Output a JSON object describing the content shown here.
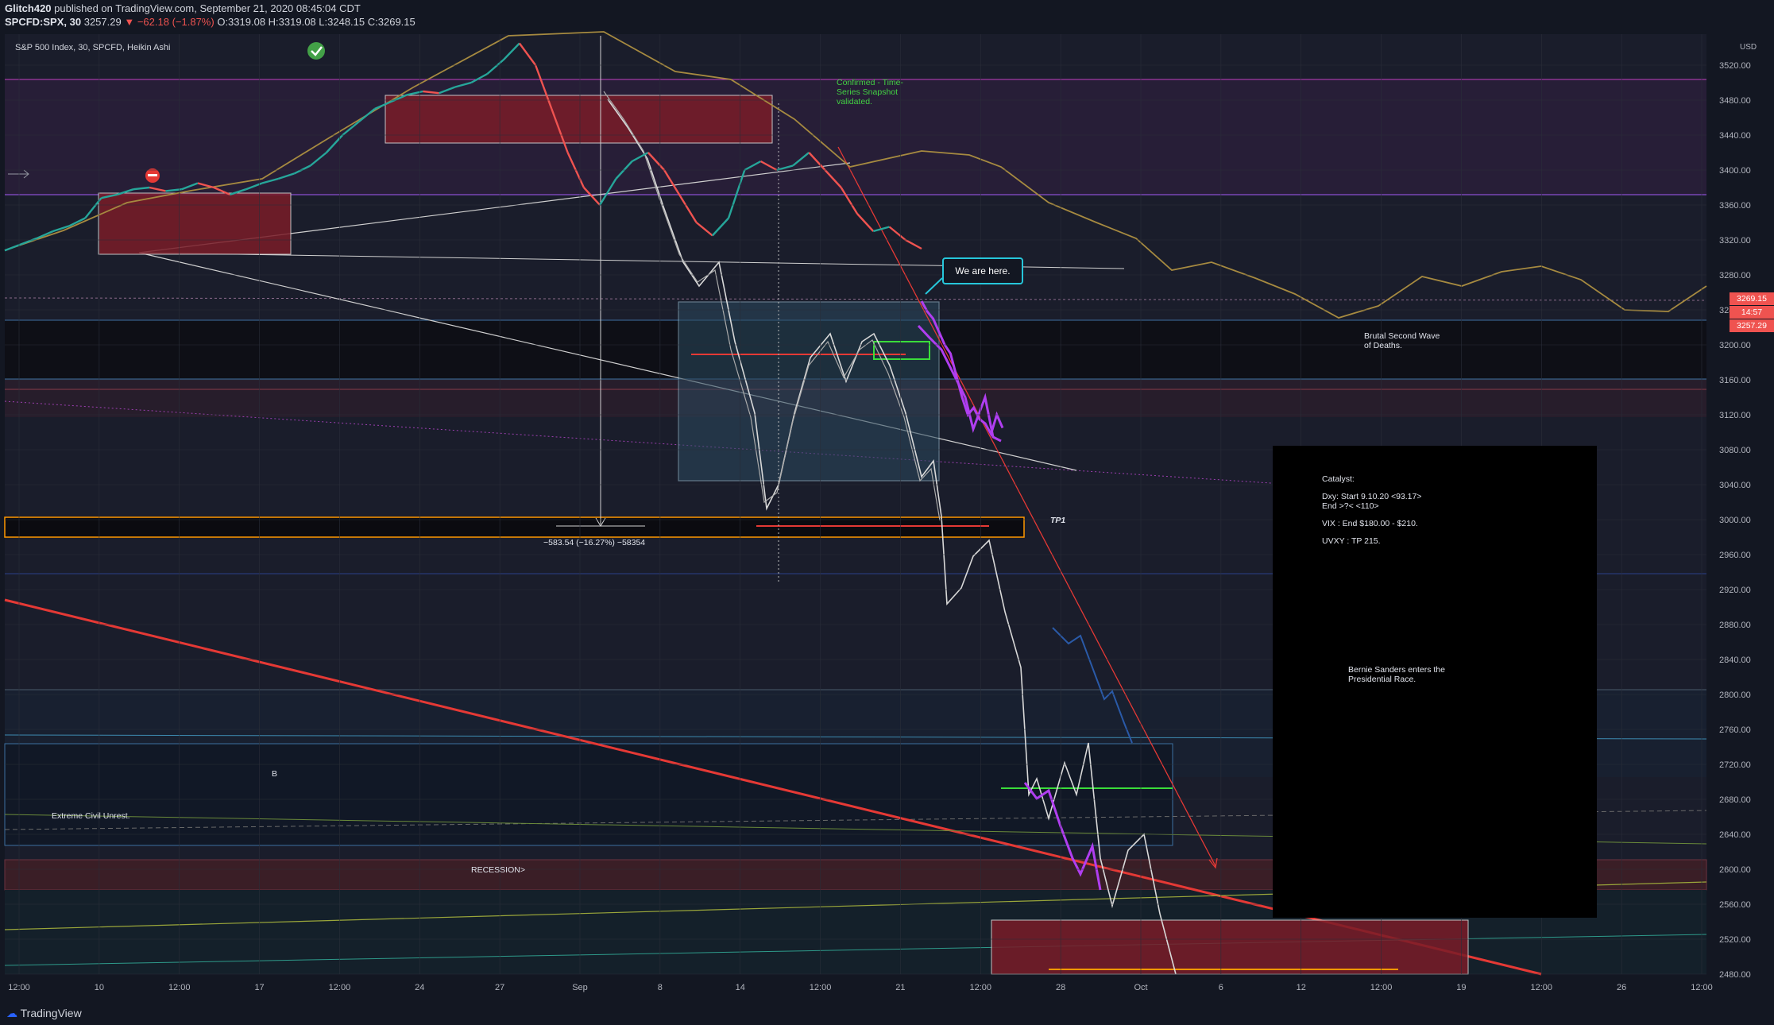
{
  "header": {
    "author": "Glitch420",
    "published": "published on TradingView.com, September 21, 2020 08:45:04 CDT",
    "symbol": "SPCFD:SPX, 30",
    "last": "3257.29",
    "change": "−62.18 (−1.87%)",
    "ohlc_o": "O:3319.08",
    "ohlc_h": "H:3319.08",
    "ohlc_l": "L:3248.15",
    "ohlc_c": "C:3269.15",
    "chart_title": "S&P 500 Index, 30, SPCFD, Heikin Ashi",
    "currency": "USD",
    "change_color": "#ef5350"
  },
  "footer": {
    "brand": "TradingView"
  },
  "annotations": {
    "confirmed": "Confirmed - Time-\nSeries Snapshot\nvalidated.",
    "we_are_here": "We are here.",
    "second_wave": "Brutal Second Wave\nof Deaths.",
    "tp1": "TP1",
    "measure": "−583.54 (−16.27%) −58354",
    "b_label": "B",
    "civil_unrest": "Extreme Civil Unrest.",
    "recession": "RECESSION>"
  },
  "catalyst": {
    "title": "Catalyst:",
    "dxy": "Dxy: Start 9.10.20 <93.17>\nEnd >?< <110>",
    "vix": "VIX : End $180.00 - $210.",
    "uvxy": "UVXY : TP 215.",
    "bernie": "Bernie Sanders enters the\nPresidential Race."
  },
  "price_tags": {
    "current": "3269.15",
    "countdown": "14:57",
    "last": "3257.29",
    "tag_color": "#ef5350"
  },
  "chart_data": {
    "type": "line",
    "title": "S&P 500 Index, 30, SPCFD, Heikin Ashi",
    "ylim": [
      2480,
      3540
    ],
    "y_ticks": [
      3520,
      3480,
      3440,
      3400,
      3360,
      3320,
      3280,
      3240,
      3200,
      3160,
      3120,
      3080,
      3040,
      3000,
      2960,
      2920,
      2880,
      2840,
      2800,
      2760,
      2720,
      2680,
      2640,
      2600,
      2560,
      2520,
      2480
    ],
    "x_ticks": [
      "12:00",
      "10",
      "12:00",
      "17",
      "12:00",
      "24",
      "27",
      "Sep",
      "8",
      "14",
      "12:00",
      "21",
      "12:00",
      "28",
      "Oct",
      "6",
      "12",
      "12:00",
      "19",
      "12:00",
      "26",
      "12:00"
    ],
    "series": [
      {
        "values": [
          3308,
          3315,
          3322,
          3330,
          3336,
          3345,
          3368,
          3372,
          3378,
          3380,
          3376,
          3378,
          3385,
          3380,
          3372,
          3378,
          3385,
          3390,
          3396,
          3405,
          3420,
          3440,
          3455,
          3470,
          3478,
          3486,
          3490,
          3488,
          3495,
          3500,
          3510,
          3526,
          3545,
          3520,
          3470,
          3420,
          3380,
          3360,
          3390,
          3410,
          3420,
          3400,
          3370,
          3340,
          3325,
          3345,
          3400,
          3410,
          3400,
          3405,
          3420,
          3400,
          3380,
          3350,
          3330,
          3335,
          3320,
          3310
        ]
      },
      {
        "values": [
          3250,
          3238,
          3230,
          3215,
          3200,
          3190,
          3165,
          3140,
          3120,
          3128,
          3115,
          3110,
          3098,
          3120,
          3105
        ]
      }
    ]
  }
}
